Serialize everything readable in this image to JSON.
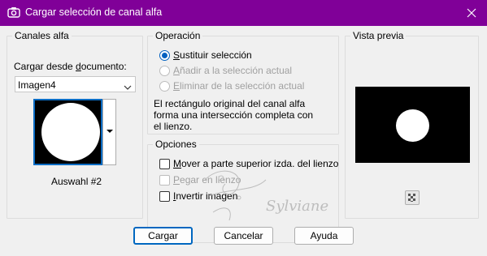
{
  "window": {
    "title": "Cargar selección de canal alfa"
  },
  "canales": {
    "legend": "Canales alfa",
    "load_label_pre": "Cargar desde ",
    "load_label_key": "d",
    "load_label_post": "ocumento:",
    "document_value": "Imagen4",
    "thumbnail_caption": "Auswahl #2"
  },
  "operacion": {
    "legend": "Operación",
    "options": [
      {
        "key": "S",
        "rest": "ustituir selección",
        "checked": true,
        "disabled": false
      },
      {
        "key": "A",
        "rest": "ñadir a la selección actual",
        "checked": false,
        "disabled": true
      },
      {
        "key": "E",
        "rest": "liminar de la selección actual",
        "checked": false,
        "disabled": true
      }
    ],
    "description": "El rectángulo original del canal alfa forma una intersección completa con el lienzo."
  },
  "opciones": {
    "legend": "Opciones",
    "items": [
      {
        "key": "M",
        "rest": "over a parte superior izda. del lienzo",
        "checked": false,
        "disabled": false
      },
      {
        "key": "P",
        "rest": "egar en lienzo",
        "checked": false,
        "disabled": true
      },
      {
        "key": "I",
        "rest": "nvertir imagen",
        "checked": false,
        "disabled": false
      }
    ]
  },
  "vista": {
    "legend": "Vista previa"
  },
  "watermark": {
    "text": "Sylviane"
  },
  "buttons": {
    "load": "Cargar",
    "cancel": "Cancelar",
    "help": "Ayuda"
  },
  "colors": {
    "titlebar": "#800098",
    "accent": "#0067c0"
  }
}
